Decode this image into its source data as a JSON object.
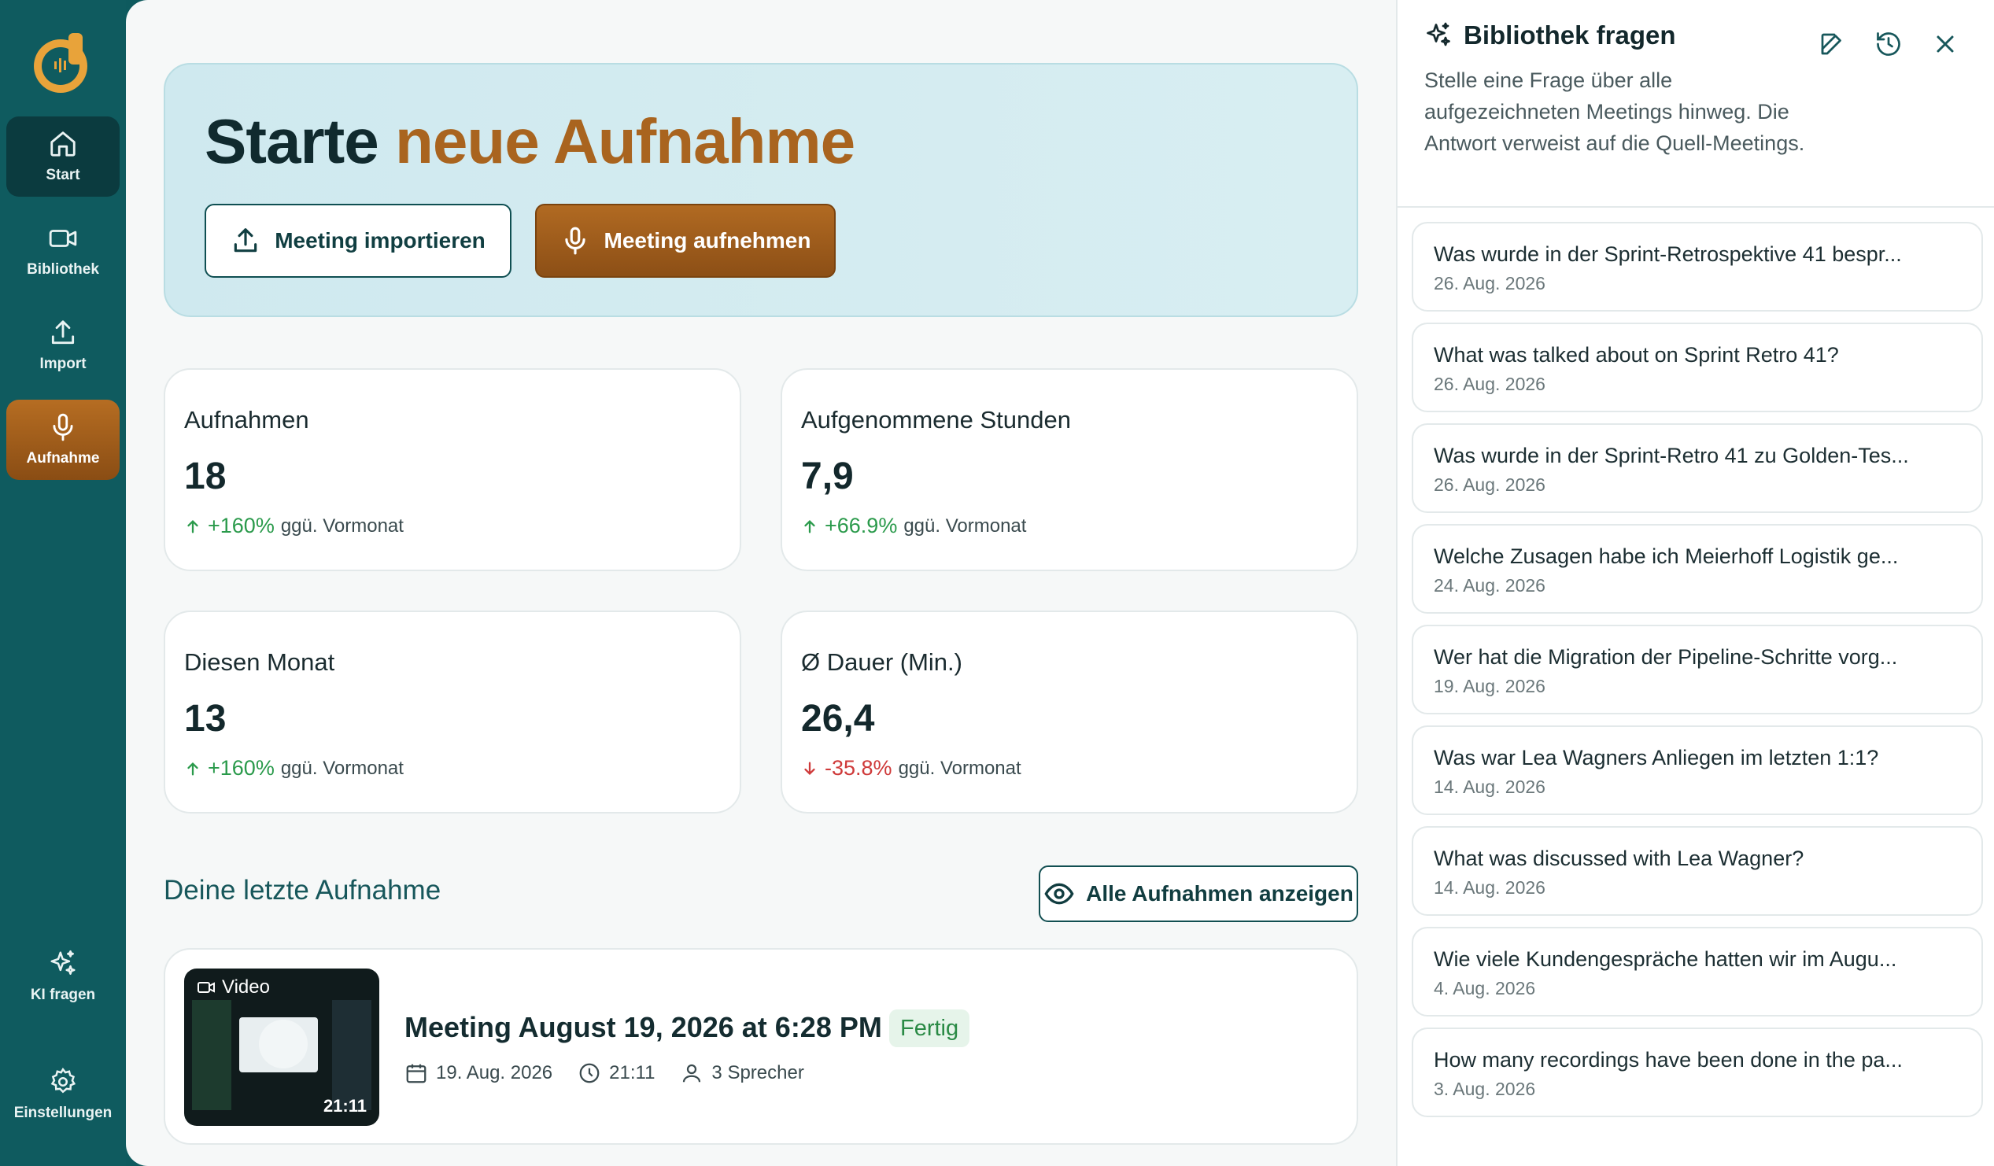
{
  "sidebar": {
    "items": [
      {
        "label": "Start",
        "icon": "home-icon"
      },
      {
        "label": "Bibliothek",
        "icon": "video-icon"
      },
      {
        "label": "Import",
        "icon": "upload-icon"
      },
      {
        "label": "Aufnahme",
        "icon": "microphone-icon"
      }
    ],
    "bottom": [
      {
        "label": "KI fragen",
        "icon": "sparkles-icon"
      },
      {
        "label": "Einstellungen",
        "icon": "gear-icon"
      }
    ]
  },
  "hero": {
    "title_part1": "Starte",
    "title_part2": "neue Aufnahme",
    "import_label": "Meeting importieren",
    "record_label": "Meeting aufnehmen"
  },
  "stats": [
    {
      "label": "Aufnahmen",
      "value": "18",
      "delta": "+160%",
      "direction": "up",
      "suffix": "ggü. Vormonat"
    },
    {
      "label": "Aufgenommene Stunden",
      "value": "7,9",
      "delta": "+66.9%",
      "direction": "up",
      "suffix": "ggü. Vormonat"
    },
    {
      "label": "Diesen Monat",
      "value": "13",
      "delta": "+160%",
      "direction": "up",
      "suffix": "ggü. Vormonat"
    },
    {
      "label": "Ø Dauer (Min.)",
      "value": "26,4",
      "delta": "-35.8%",
      "direction": "down",
      "suffix": "ggü. Vormonat"
    }
  ],
  "recent": {
    "section_title": "Deine letzte Aufnahme",
    "show_all_label": "Alle Aufnahmen anzeigen",
    "thumb_tag": "Video",
    "thumb_duration": "21:11",
    "title": "Meeting August 19, 2026 at 6:28 PM",
    "status": "Fertig",
    "date": "19. Aug. 2026",
    "duration": "21:11",
    "speakers": "3 Sprecher"
  },
  "panel": {
    "title": "Bibliothek fragen",
    "description": "Stelle eine Frage über alle aufgezeichneten Meetings hinweg. Die Antwort verweist auf die Quell-Meetings.",
    "questions": [
      {
        "q": "Was wurde in der Sprint-Retrospektive 41 bespr...",
        "d": "26. Aug. 2026"
      },
      {
        "q": "What was talked about on Sprint Retro 41?",
        "d": "26. Aug. 2026"
      },
      {
        "q": "Was wurde in der Sprint-Retro 41 zu Golden-Tes...",
        "d": "26. Aug. 2026"
      },
      {
        "q": "Welche Zusagen habe ich Meierhoff Logistik ge...",
        "d": "24. Aug. 2026"
      },
      {
        "q": "Wer hat die Migration der Pipeline-Schritte vorg...",
        "d": "19. Aug. 2026"
      },
      {
        "q": "Was war Lea Wagners Anliegen im letzten 1:1?",
        "d": "14. Aug. 2026"
      },
      {
        "q": "What was discussed with Lea Wagner?",
        "d": "14. Aug. 2026"
      },
      {
        "q": "Wie viele Kundengespräche hatten wir im Augu...",
        "d": "4. Aug. 2026"
      },
      {
        "q": "How many recordings have been done in the pa...",
        "d": "3. Aug. 2026"
      }
    ]
  }
}
